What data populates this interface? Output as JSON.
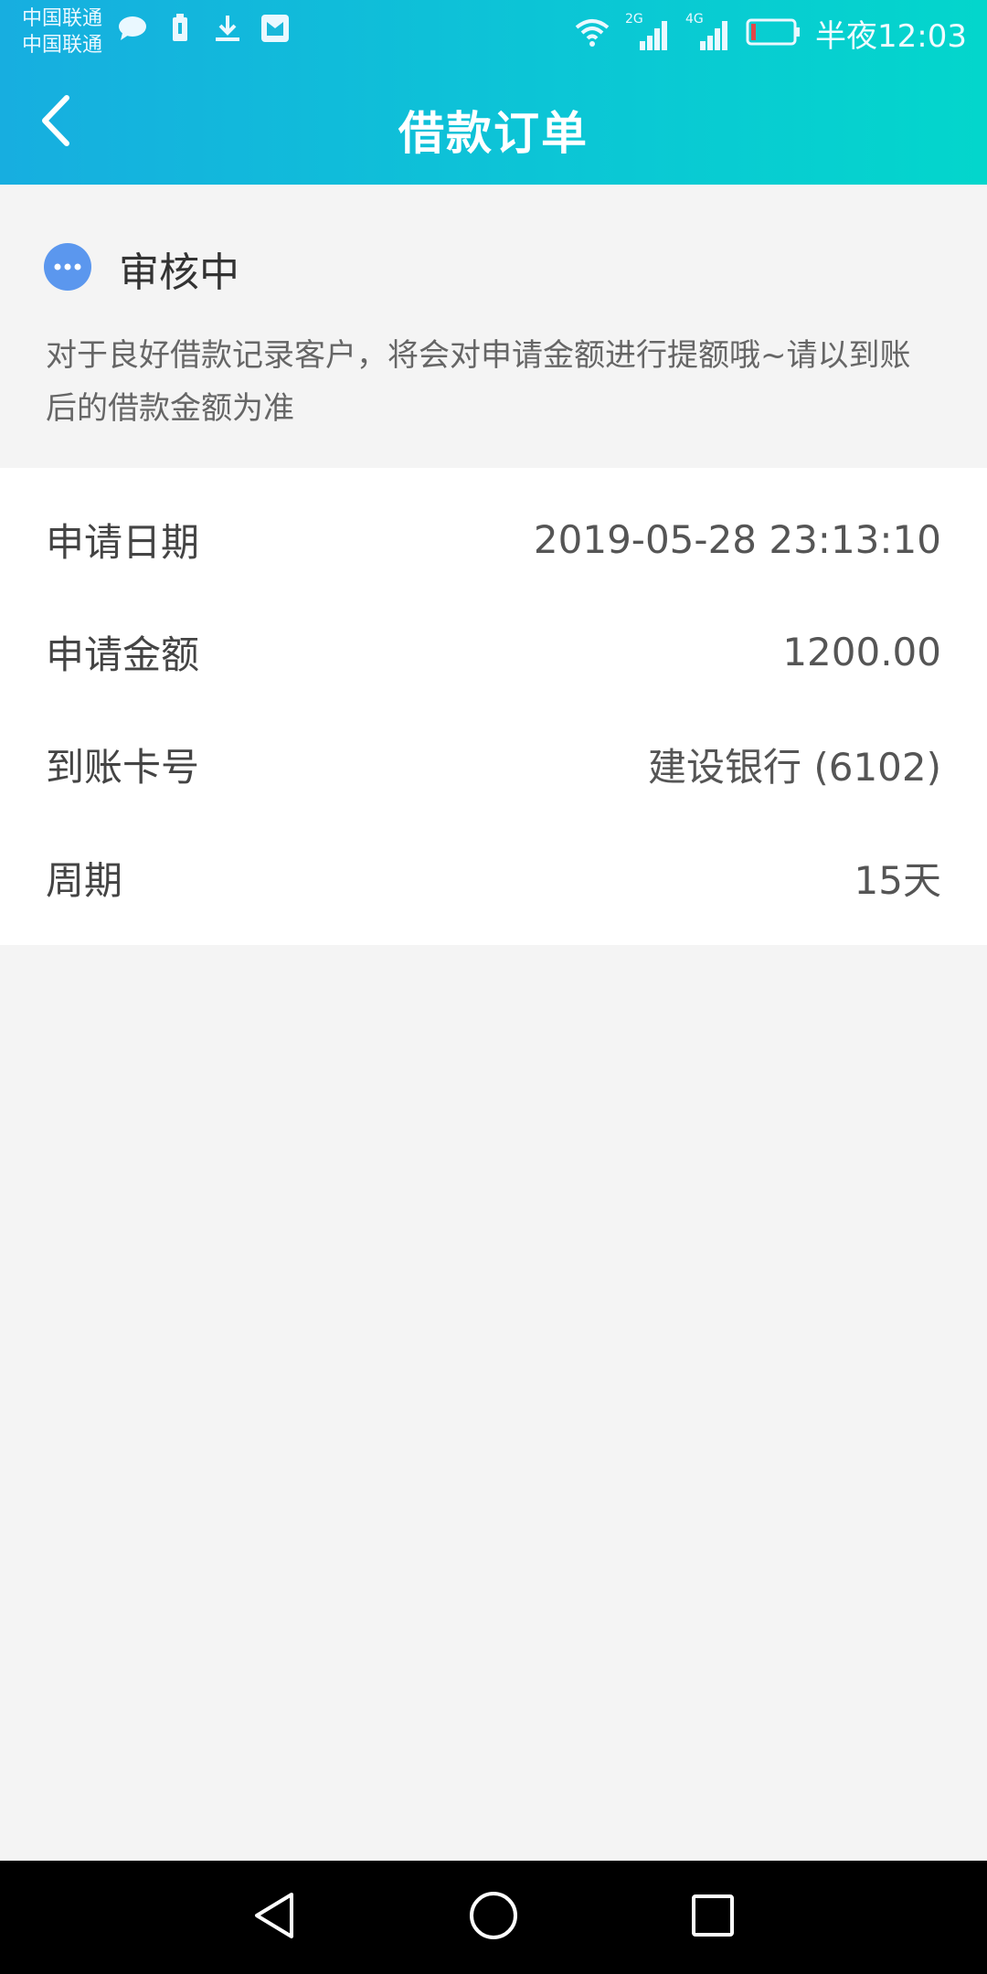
{
  "status_bar": {
    "carrier_1": "中国联通",
    "carrier_2": "中国联通",
    "signal_1_label": "2G",
    "signal_2_label": "4G",
    "time": "半夜12:03"
  },
  "header": {
    "title": "借款订单"
  },
  "status": {
    "label": "审核中",
    "description": "对于良好借款记录客户，将会对申请金额进行提额哦~请以到账后的借款金额为准"
  },
  "details": [
    {
      "label": "申请日期",
      "value": "2019-05-28 23:13:10"
    },
    {
      "label": "申请金额",
      "value": "1200.00"
    },
    {
      "label": "到账卡号",
      "value": "建设银行 (6102)"
    },
    {
      "label": "周期",
      "value": "15天"
    }
  ],
  "icons": {
    "back": "chevron-left-icon",
    "status": "more-dots-icon",
    "nav_back": "triangle-back-icon",
    "nav_home": "circle-home-icon",
    "nav_recent": "square-recent-icon"
  }
}
